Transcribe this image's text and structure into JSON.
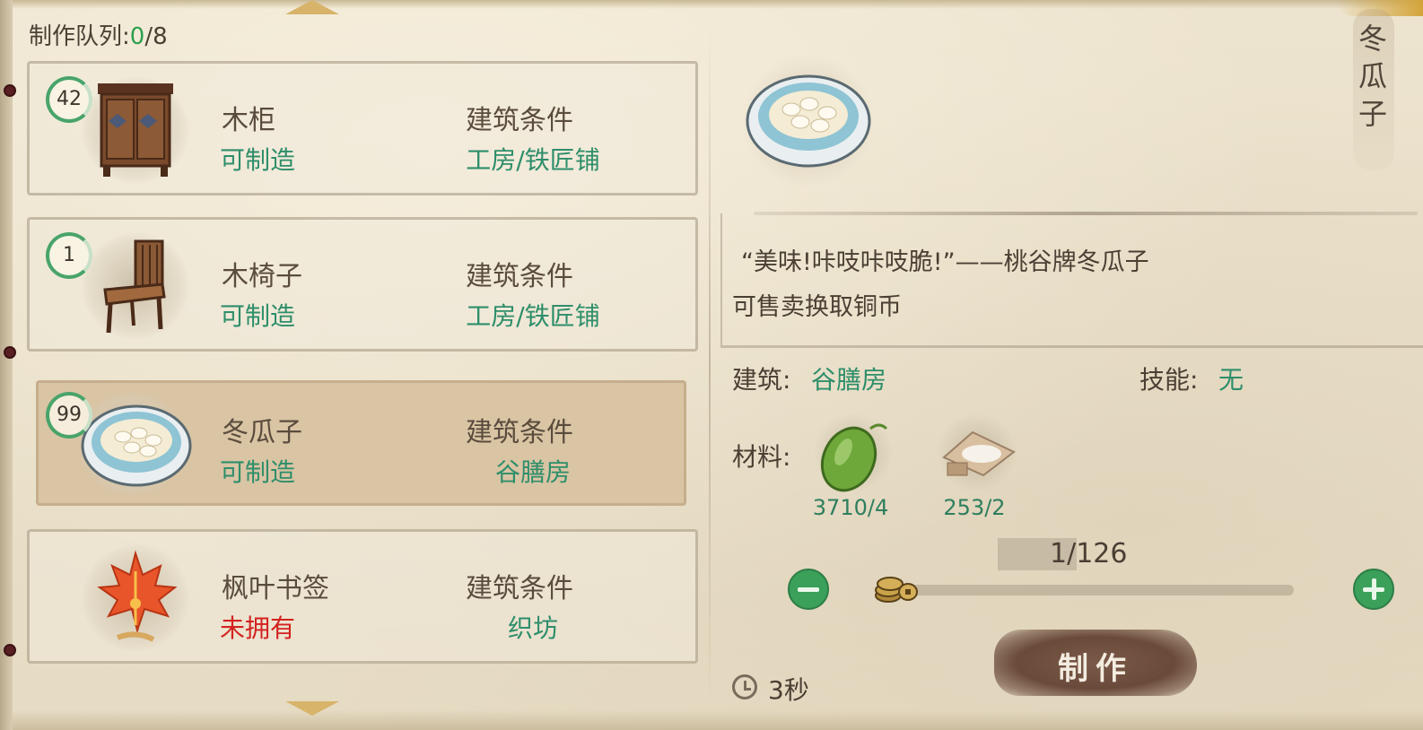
{
  "queue": {
    "label": "制作队列:",
    "current": "0",
    "max": "/8"
  },
  "recipes": [
    {
      "count": "42",
      "name": "木柜",
      "status": "可制造",
      "cond_title": "建筑条件",
      "cond_value": "工房/铁匠铺",
      "icon": "wooden-cabinet-icon",
      "available": true
    },
    {
      "count": "1",
      "name": "木椅子",
      "status": "可制造",
      "cond_title": "建筑条件",
      "cond_value": "工房/铁匠铺",
      "icon": "wooden-chair-icon",
      "available": true
    },
    {
      "count": "99",
      "name": "冬瓜子",
      "status": "可制造",
      "cond_title": "建筑条件",
      "cond_value": "谷膳房",
      "icon": "seed-bowl-icon",
      "available": true,
      "selected": true
    },
    {
      "count": "",
      "name": "枫叶书签",
      "status": "未拥有",
      "cond_title": "建筑条件",
      "cond_value": "织坊",
      "icon": "maple-leaf-icon",
      "available": false
    }
  ],
  "detail": {
    "title": "冬瓜子",
    "title_chars": [
      "冬",
      "瓜",
      "子"
    ],
    "desc_line1": "“美味!咔吱咔吱脆!”——桃谷牌冬瓜子",
    "desc_line2": "可售卖换取铜币",
    "building_label": "建筑:",
    "building_value": "谷膳房",
    "skill_label": "技能:",
    "skill_value": "无",
    "materials_label": "材料:",
    "materials": [
      {
        "icon": "winter-melon-icon",
        "count": "3710/4"
      },
      {
        "icon": "flour-pack-icon",
        "count": "253/2"
      }
    ],
    "quantity": "1/126",
    "make_label": "制作",
    "time": "3秒"
  },
  "colors": {
    "green": "#2e8e6a",
    "red": "#d3221f",
    "button_green": "#3aa05a",
    "make_button": "#6a4a3a",
    "selected_card": "#d9c4a4"
  }
}
